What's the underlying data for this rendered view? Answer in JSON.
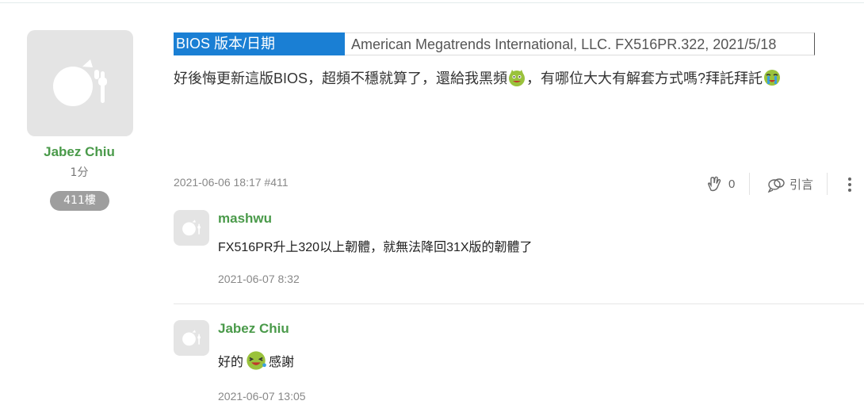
{
  "post": {
    "author": "Jabez Chiu",
    "score": "1分",
    "floor": "411樓",
    "bios_key": "BIOS 版本/日期",
    "bios_value": "American Megatrends International, LLC. FX516PR.322, 2021/5/18",
    "message_part1": "好後悔更新這版BIOS，超頻不穩就算了，還給我黑頻",
    "message_part2": "，有哪位大大有解套方式嗎?拜託拜託",
    "meta": "2021-06-06 18:17 #411",
    "like_count": "0",
    "quote_label": "引言"
  },
  "replies": [
    {
      "author": "mashwu",
      "text": "FX516PR升上320以上韌體，就無法降回31X版的韌體了",
      "date": "2021-06-07 8:32"
    },
    {
      "author": "Jabez Chiu",
      "text_part1": "好的",
      "text_part2": "感謝",
      "date": "2021-06-07 13:05"
    }
  ],
  "colors": {
    "accent_green": "#4a9a4a",
    "bios_highlight": "#1a7fd4",
    "floor_badge": "#9e9e9e"
  },
  "icons": [
    "avatar-placeholder-icon",
    "clap-icon",
    "quote-icon",
    "more-vertical-icon",
    "emoji-devil-icon",
    "emoji-crying-icon",
    "emoji-laugh-icon"
  ]
}
